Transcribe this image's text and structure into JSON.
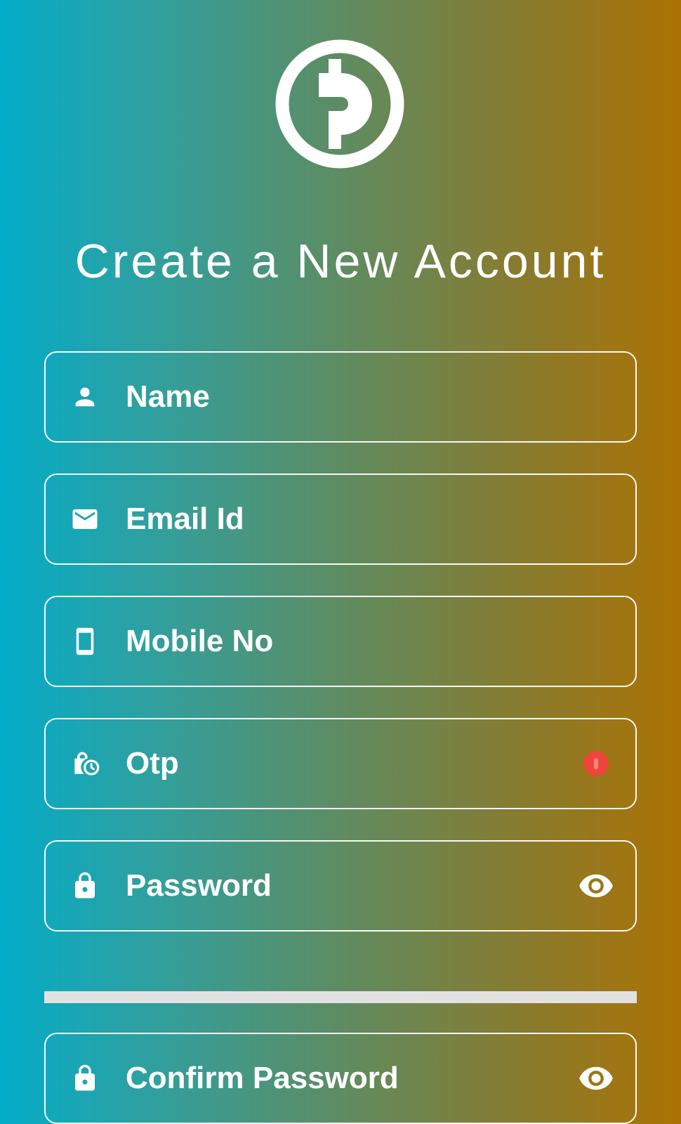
{
  "header": {
    "title": "Create a New Account",
    "logo_icon": "coin-d-logo-icon"
  },
  "form": {
    "fields": [
      {
        "label": "Name",
        "icon": "person-icon"
      },
      {
        "label": "Email Id",
        "icon": "mail-icon"
      },
      {
        "label": "Mobile No",
        "icon": "smartphone-icon"
      },
      {
        "label": "Otp",
        "icon": "lock-clock-icon",
        "trailing": "error-badge-icon"
      },
      {
        "label": "Password",
        "icon": "lock-icon",
        "trailing": "eye-icon"
      },
      {
        "label": "Confirm Password",
        "icon": "lock-icon",
        "trailing": "eye-icon"
      }
    ],
    "password_strength": {
      "fill": 1.0,
      "color": "#e2e2e2"
    }
  },
  "colors": {
    "gradient_start": "#03acc9",
    "gradient_end": "#ac7304",
    "error": "#f0453b",
    "foreground": "#ffffff"
  }
}
